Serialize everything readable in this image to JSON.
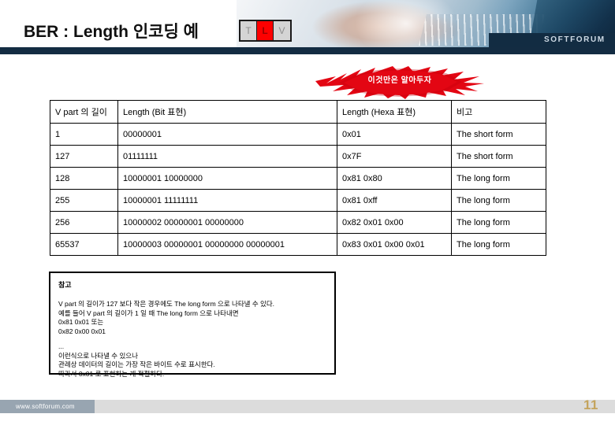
{
  "slide": {
    "title": "BER : Length 인코딩 예",
    "page_number": "11"
  },
  "header": {
    "logo_text": "SOFTFORUM",
    "photo_alt": "laptop-typing-photo"
  },
  "tlv": {
    "cells": [
      {
        "label": "T",
        "active": false
      },
      {
        "label": "L",
        "active": true
      },
      {
        "label": "V",
        "active": false
      }
    ],
    "active_color": "#fe0000"
  },
  "callout": {
    "text": "이것만은 알아두자",
    "fill_color": "#e30613"
  },
  "table": {
    "headers": [
      "V part 의 길이",
      "Length (Bit 표현)",
      "Length (Hexa 표현)",
      "비고"
    ],
    "rows": [
      {
        "length": "1",
        "bits": "00000001",
        "hex": "0x01",
        "note": "The short form",
        "note_kind": "short"
      },
      {
        "length": "127",
        "bits": "01111111",
        "hex": "0x7F",
        "note": "The short form",
        "note_kind": "short"
      },
      {
        "length": "128",
        "bits": "10000001 10000000",
        "hex": "0x81 0x80",
        "note": "The long form",
        "note_kind": "long"
      },
      {
        "length": "255",
        "bits": "10000001 11111111",
        "hex": "0x81 0xff",
        "note": "The long form",
        "note_kind": "long"
      },
      {
        "length": "256",
        "bits": "10000002 00000001 00000000",
        "hex": "0x82 0x01 0x00",
        "note": "The long form",
        "note_kind": "long"
      },
      {
        "length": "65537",
        "bits": "10000003 00000001 00000000 00000001",
        "hex": "0x83 0x01 0x00 0x01",
        "note": "The long form",
        "note_kind": "long"
      }
    ],
    "note_colors": {
      "short": "#262f6e",
      "long": "#c10f17"
    }
  },
  "note_box": {
    "title": "참고",
    "lines": [
      "V part 의 길이가 127 보다 작은 경우에도 The long form 으로 나타낼 수 있다.",
      "예를 들어 V part 의 길이가 1 일 때 The long form 으로 나타내면",
      "0x81 0x01 또는",
      "0x82 0x00 0x01",
      "",
      "...",
      "이런식으로 나타낼 수 있으나",
      "관례상 데이터의 길이는 가장 작은 바이트 수로 표시한다.",
      "따라서 0x01 로 표현하는 게 적절하다."
    ]
  },
  "footer": {
    "url": "www.softforum.com"
  }
}
